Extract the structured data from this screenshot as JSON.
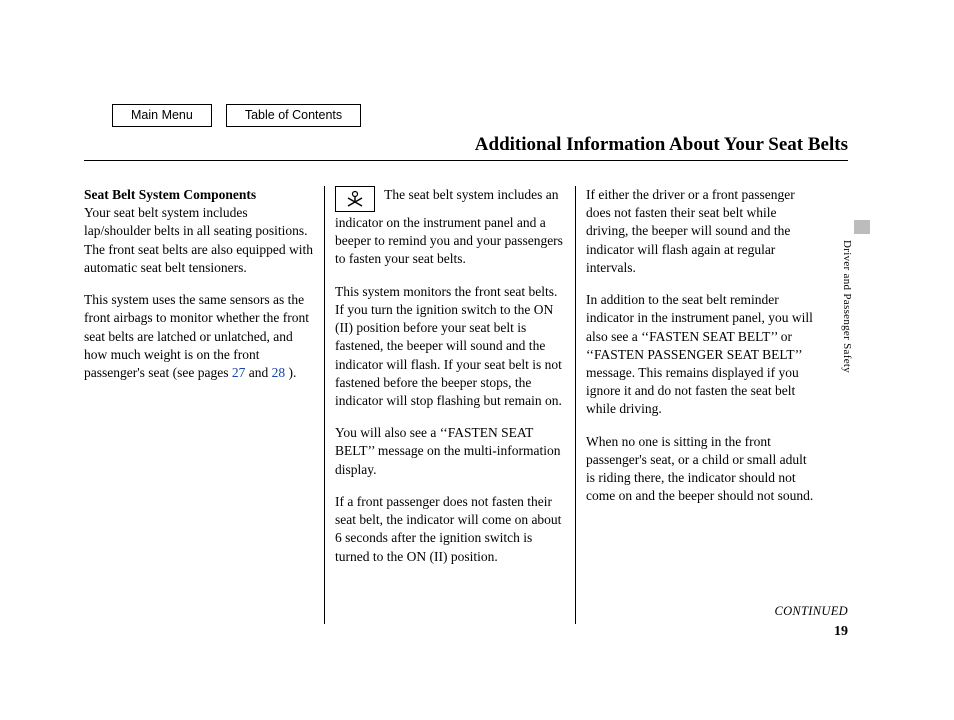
{
  "nav": {
    "main_menu": "Main Menu",
    "toc": "Table of Contents"
  },
  "title": "Additional Information About Your Seat Belts",
  "col1": {
    "subheading": "Seat Belt System Components",
    "p1": "Your seat belt system includes lap/shoulder belts in all seating positions. The front seat belts are also equipped with automatic seat belt tensioners.",
    "p2a": "This system uses the same sensors as the front airbags to monitor whether the front seat belts are latched or unlatched, and how much weight is on the front passenger's seat (see pages ",
    "link27": "27",
    "and": " and ",
    "link28": "28",
    "p2b": " )."
  },
  "col2": {
    "p1": "The seat belt system includes an indicator on the instrument panel and a beeper to remind you and your passengers to fasten your seat belts.",
    "p2": "This system monitors the front seat belts. If you turn the ignition switch to the ON (II) position before your seat belt is fastened, the beeper will sound and the indicator will flash. If your seat belt is not fastened before the beeper stops, the indicator will stop flashing but remain on.",
    "p3": "You will also see a ‘‘FASTEN SEAT BELT’’ message on the multi-information display.",
    "p4": "If a front passenger does not fasten their seat belt, the indicator will come on about 6 seconds after the ignition switch is turned to the ON (II) position."
  },
  "col3": {
    "p1": "If either the driver or a front passenger does not fasten their seat belt while driving, the beeper will sound and the indicator will flash again at regular intervals.",
    "p2": "In addition to the seat belt reminder indicator in the instrument panel, you will also see a ‘‘FASTEN SEAT BELT’’ or ‘‘FASTEN PASSENGER SEAT BELT’’ message. This remains displayed if you ignore it and do not fasten the seat belt while driving.",
    "p3": "When no one is sitting in the front passenger's seat, or a child or small adult is riding there, the indicator should not come on and the beeper should not sound."
  },
  "continued": "CONTINUED",
  "page_number": "19",
  "side_label": "Driver and Passenger Safety"
}
